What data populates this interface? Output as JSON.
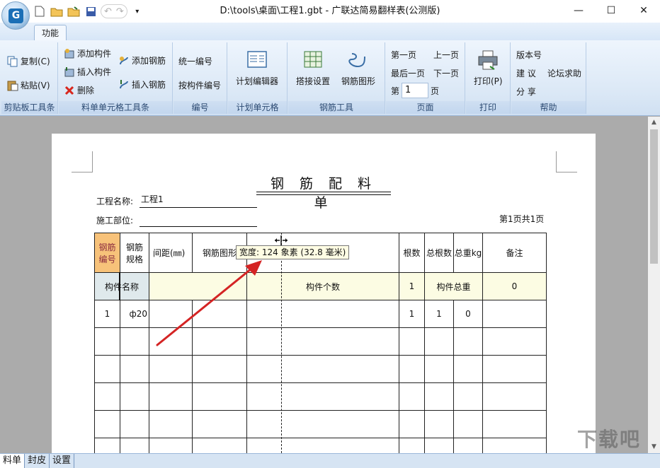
{
  "window": {
    "title": "D:\\tools\\桌面\\工程1.gbt - 广联达简易翻样表(公测版)",
    "minimize": "—",
    "maximize": "☐",
    "close": "✕"
  },
  "ribbon_tab": "功能",
  "groups": {
    "clipboard": {
      "label": "剪贴板工具条",
      "copy": "复制(C)",
      "paste": "粘贴(V)"
    },
    "cell_tools": {
      "label": "料单单元格工具条",
      "add_component": "添加构件",
      "insert_component": "插入构件",
      "delete": "删除",
      "add_rebar": "添加钢筋",
      "insert_rebar": "插入钢筋"
    },
    "numbering": {
      "label": "编号",
      "unified": "统一编号",
      "by_component": "按构件编号"
    },
    "plan_cell": {
      "label": "计划单元格",
      "plan_editor": "计划编辑器"
    },
    "rebar_tools": {
      "label": "钢筋工具",
      "splice_settings": "搭接设置",
      "rebar_shape": "钢筋图形"
    },
    "page": {
      "label": "页面",
      "first": "第一页",
      "prev": "上一页",
      "last": "最后一页",
      "next": "下一页",
      "page_prefix": "第",
      "page_value": "1",
      "page_suffix": "页"
    },
    "print": {
      "label": "打印",
      "print": "打印(P)"
    },
    "help": {
      "label": "帮助",
      "version": "版本号",
      "suggest": "建 议",
      "forum": "论坛求助",
      "share": "分 享"
    }
  },
  "document": {
    "title": "钢 筋 配 料 单",
    "project_label": "工程名称:",
    "project_value": "工程1",
    "location_label": "施工部位:",
    "page_info": "第1页共1页"
  },
  "table": {
    "headers": [
      "钢筋编号",
      "钢筋规格",
      "间距(㎜)",
      "钢筋图形",
      "",
      "根数",
      "总根数",
      "总重kg",
      "备注"
    ],
    "component_row": {
      "name": "构件名称",
      "count_label": "构件个数",
      "count_value": "1",
      "total_label": "构件总重",
      "total_value": "0"
    },
    "data_row": {
      "number": "1",
      "spec": "ф20",
      "roots": "1",
      "total_roots": "1",
      "total_weight": "0"
    }
  },
  "tooltip": "宽度: 124 象素 (32.8 毫米)",
  "sheet_tabs": [
    "料单",
    "封皮",
    "设置"
  ],
  "watermark": "下载吧"
}
